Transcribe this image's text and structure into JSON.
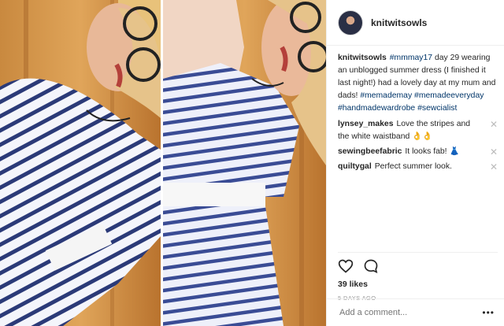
{
  "post": {
    "username": "knitwitsowls",
    "caption_user": "knitwitsowls",
    "caption_parts": [
      {
        "text": "#mmmay17",
        "tag": true
      },
      {
        "text": " day 29 wearing an unblogged summer dress (I finished it last night!) had a lovely day at my mum and dads! ",
        "tag": false
      },
      {
        "text": "#memademay",
        "tag": true
      },
      {
        "text": " ",
        "tag": false
      },
      {
        "text": "#memadeeveryday",
        "tag": true
      },
      {
        "text": " ",
        "tag": false
      },
      {
        "text": "#handmadewardrobe",
        "tag": true
      },
      {
        "text": " ",
        "tag": false
      },
      {
        "text": "#sewcialist",
        "tag": true
      }
    ],
    "comments": [
      {
        "user": "lynsey_makes",
        "text": "Love the stripes and the white waistband 👌👌"
      },
      {
        "user": "sewingbeefabric",
        "text": "It looks fab! 👗"
      },
      {
        "user": "quiltygal",
        "text": "Perfect summer look."
      }
    ],
    "likes": "39 likes",
    "posted_ago": "5 DAYS AGO",
    "add_comment_placeholder": "Add a comment...",
    "more_options": "•••"
  },
  "icons": {
    "like": "heart-icon",
    "comment": "comment-bubble-icon",
    "remove_comment": "close-icon"
  }
}
